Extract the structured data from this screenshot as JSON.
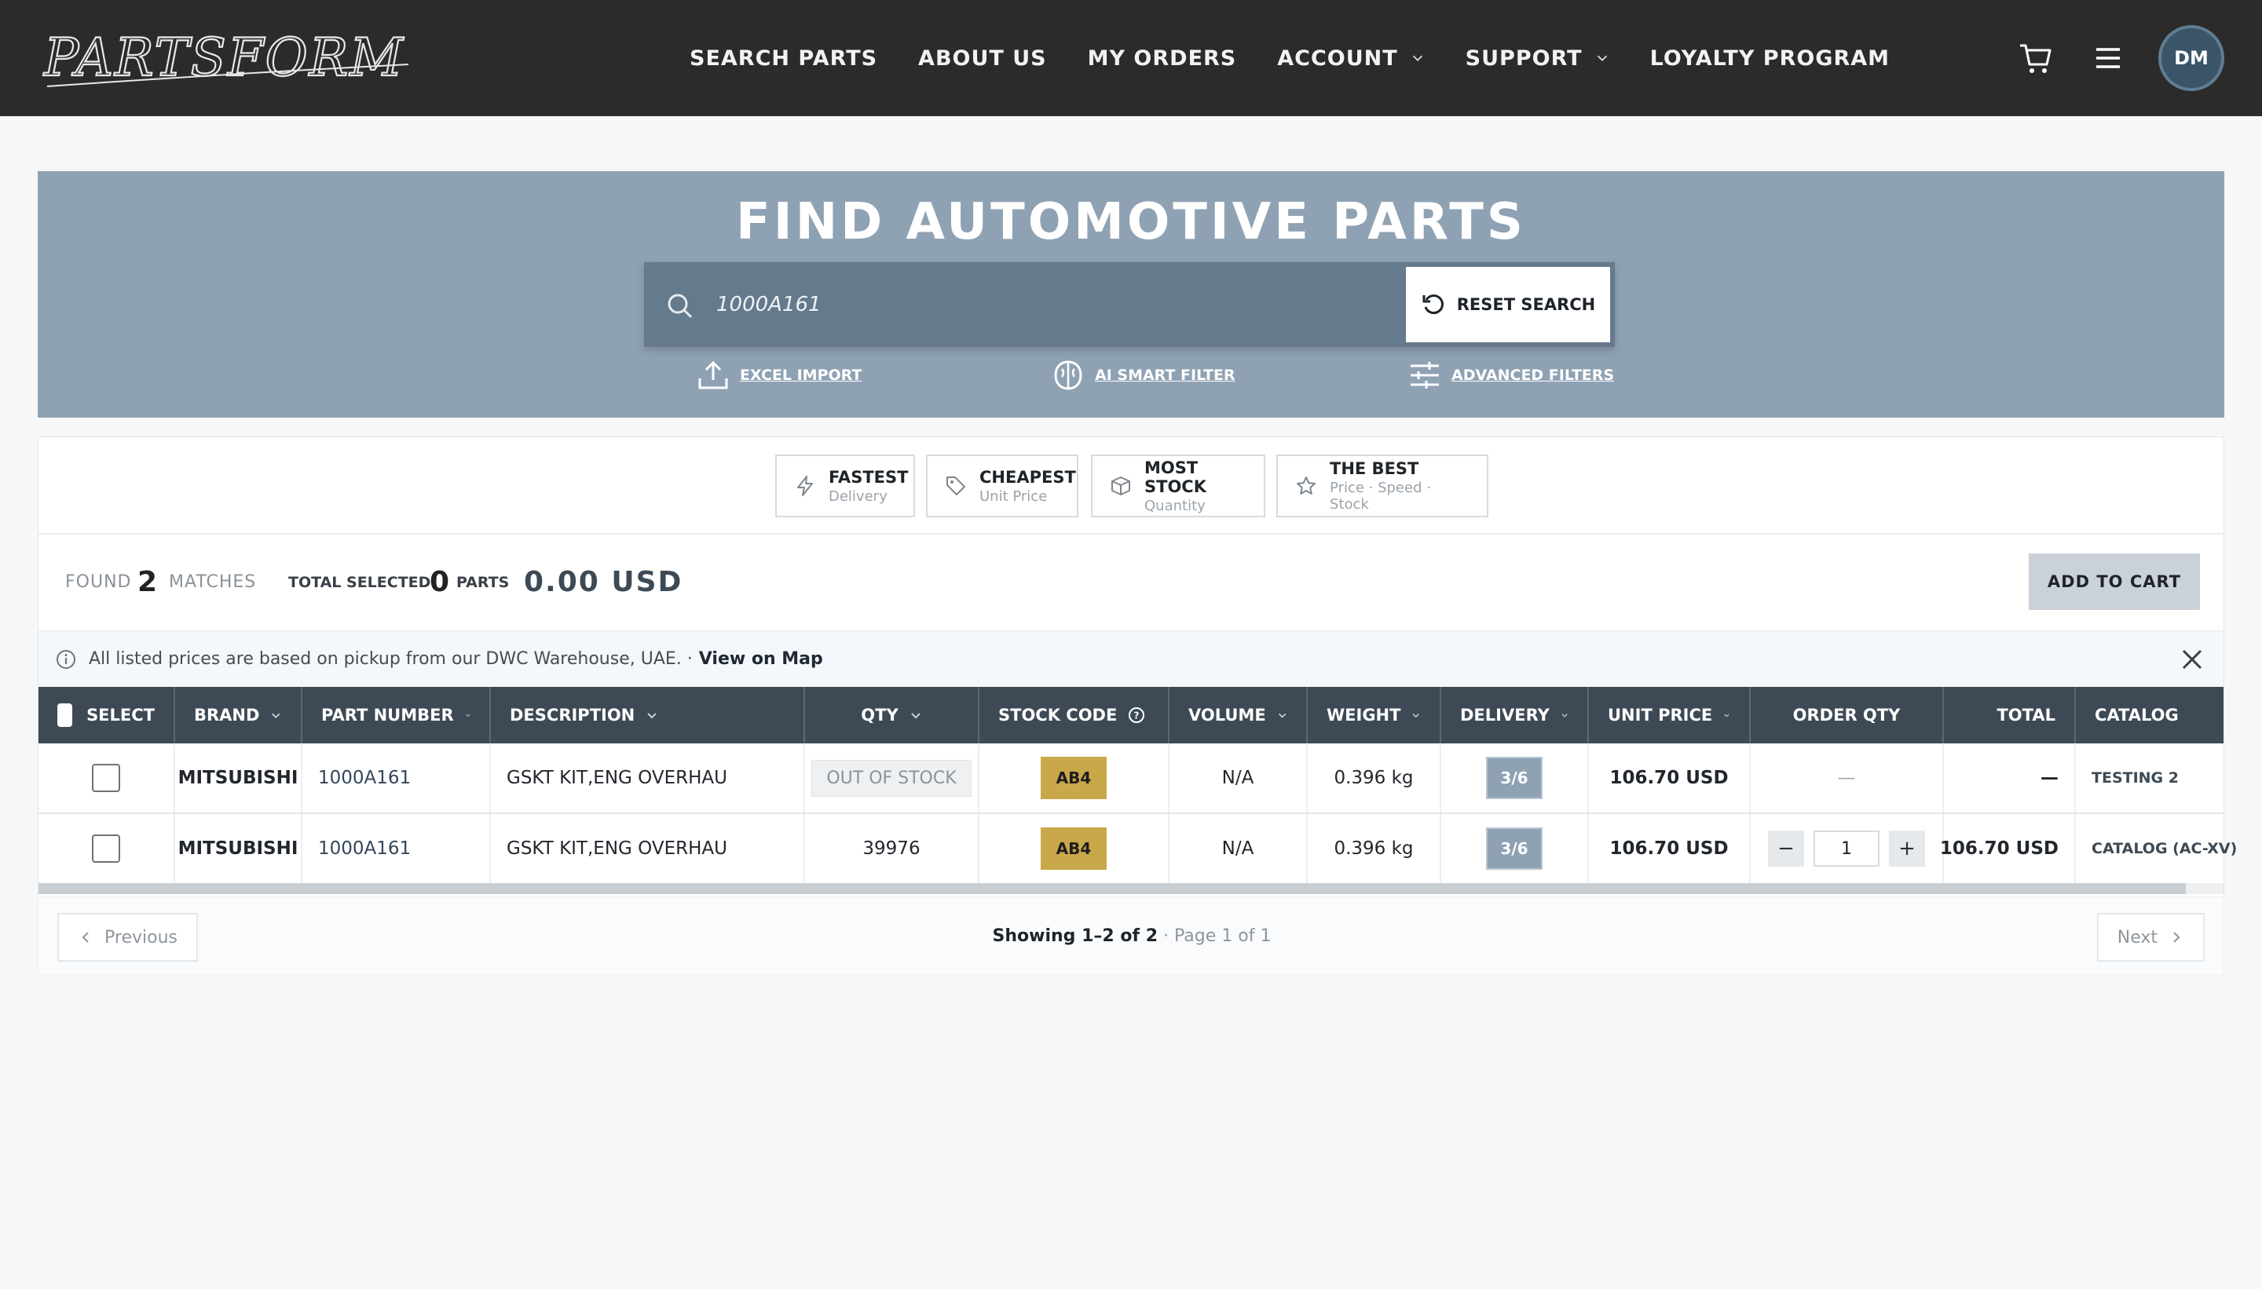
{
  "header": {
    "logo_text": "PARTSFORM",
    "nav": [
      {
        "label": "SEARCH PARTS",
        "dropdown": false
      },
      {
        "label": "ABOUT US",
        "dropdown": false
      },
      {
        "label": "MY ORDERS",
        "dropdown": false
      },
      {
        "label": "ACCOUNT",
        "dropdown": true
      },
      {
        "label": "SUPPORT",
        "dropdown": true
      },
      {
        "label": "LOYALTY PROGRAM",
        "dropdown": false
      }
    ],
    "avatar_initials": "DM"
  },
  "search": {
    "title": "FIND AUTOMOTIVE PARTS",
    "query": "1000A161",
    "reset_label": "RESET SEARCH",
    "links": {
      "excel": "EXCEL IMPORT",
      "ai": "AI SMART FILTER",
      "advanced": "ADVANCED FILTERS"
    }
  },
  "sort_options": [
    {
      "title": "FASTEST",
      "sub": "Delivery",
      "icon": "lightning-icon"
    },
    {
      "title": "CHEAPEST",
      "sub": "Unit Price",
      "icon": "tag-icon"
    },
    {
      "title": "MOST STOCK",
      "sub": "Quantity",
      "icon": "box-icon"
    },
    {
      "title": "THE BEST",
      "sub": "Price · Speed · Stock",
      "icon": "star-icon"
    }
  ],
  "summary": {
    "found_label": "FOUND",
    "found_count": "2",
    "matches_label": "MATCHES",
    "total_selected_label": "TOTAL SELECTED",
    "selected_count": "0",
    "parts_label": "PARTS",
    "total_value": "0.00 USD",
    "add_to_cart": "ADD TO CART"
  },
  "info": {
    "text": "All listed prices are based on pickup from our DWC Warehouse, UAE. ·",
    "link": "View on Map"
  },
  "table": {
    "headers": {
      "select": "SELECT",
      "brand": "BRAND",
      "part_number": "PART NUMBER",
      "description": "DESCRIPTION",
      "qty": "QTY",
      "stock_code": "STOCK CODE",
      "volume": "VOLUME",
      "weight": "WEIGHT",
      "delivery": "DELIVERY",
      "unit_price": "UNIT PRICE",
      "order_qty": "ORDER QTY",
      "total": "TOTAL",
      "catalog": "CATALOG"
    },
    "rows": [
      {
        "brand": "MITSUBISHI",
        "part_number": "1000A161",
        "description": "GSKT KIT,ENG OVERHAU",
        "qty": "OUT OF STOCK",
        "stock_code": "AB4",
        "volume": "N/A",
        "weight": "0.396 kg",
        "delivery": "3/6",
        "unit_price": "106.70 USD",
        "order_qty": "—",
        "total": "—",
        "catalog": "TESTING 2"
      },
      {
        "brand": "MITSUBISHI",
        "part_number": "1000A161",
        "description": "GSKT KIT,ENG OVERHAU",
        "qty": "39976",
        "stock_code": "AB4",
        "volume": "N/A",
        "weight": "0.396 kg",
        "delivery": "3/6",
        "unit_price": "106.70 USD",
        "order_qty": "1",
        "total": "106.70 USD",
        "catalog": "CATALOG (AC-XV)"
      }
    ]
  },
  "pagination": {
    "previous": "Previous",
    "showing": "Showing 1–2 of 2",
    "page": "· Page 1 of 1",
    "next": "Next"
  }
}
